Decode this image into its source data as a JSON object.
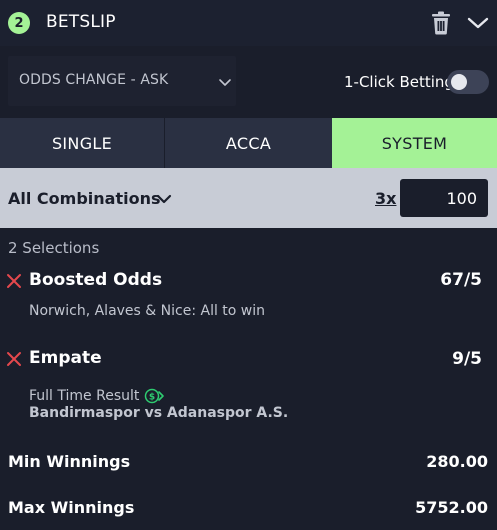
{
  "header": {
    "count": "2",
    "title": "BETSLIP",
    "icons": [
      "trash-icon",
      "chevron-down-icon"
    ]
  },
  "settings": {
    "odds_change_label": "ODDS CHANGE - ASK",
    "one_click_label": "1-Click Betting",
    "one_click_enabled": false
  },
  "tabs": [
    {
      "label": "SINGLE",
      "active": false
    },
    {
      "label": "ACCA",
      "active": false
    },
    {
      "label": "SYSTEM",
      "active": true
    }
  ],
  "combination": {
    "label": "All Combinations",
    "multiplier": "3x",
    "stake": "100"
  },
  "selections_count": "2 Selections",
  "selections": [
    {
      "name": "Boosted Odds",
      "odds": "67/5",
      "description": "Norwich, Alaves & Nice: All to win"
    },
    {
      "name": "Empate",
      "odds": "9/5",
      "market": "Full Time Result",
      "event": "Bandirmaspor vs Adanaspor A.S."
    }
  ],
  "summary": {
    "min_label": "Min Winnings",
    "min_value": "280.00",
    "max_label": "Max Winnings",
    "max_value": "5752.00"
  },
  "colors": {
    "accent": "#a4f296",
    "background": "#1a1e2b",
    "remove": "#e5484d"
  }
}
